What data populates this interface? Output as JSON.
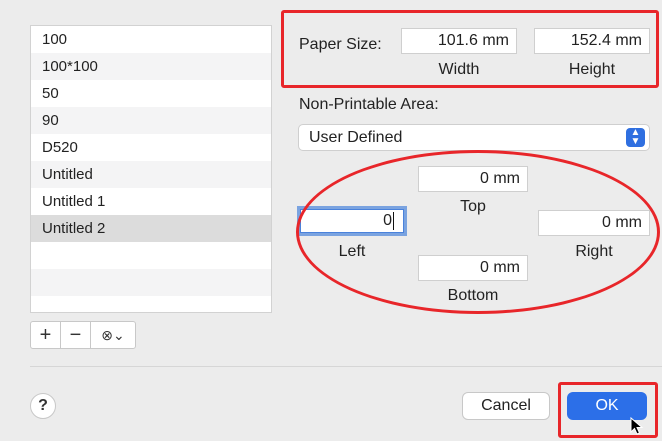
{
  "paper_list": {
    "items": [
      {
        "label": "100"
      },
      {
        "label": "100*100"
      },
      {
        "label": "50"
      },
      {
        "label": "90"
      },
      {
        "label": "D520"
      },
      {
        "label": "Untitled"
      },
      {
        "label": "Untitled 1"
      },
      {
        "label": "Untitled 2",
        "selected": true
      }
    ]
  },
  "toolbar": {
    "add_label": "+",
    "remove_label": "−",
    "options_label": "⊗⌄"
  },
  "paper_size": {
    "label": "Paper Size:",
    "width_value": "101.6 mm",
    "height_value": "152.4 mm",
    "width_caption": "Width",
    "height_caption": "Height"
  },
  "non_printable": {
    "label": "Non-Printable Area:",
    "selected_option": "User Defined",
    "top_value": "0 mm",
    "top_caption": "Top",
    "left_value": "0",
    "left_caption": "Left",
    "right_value": "0 mm",
    "right_caption": "Right",
    "bottom_value": "0 mm",
    "bottom_caption": "Bottom"
  },
  "buttons": {
    "help": "?",
    "cancel": "Cancel",
    "ok": "OK"
  },
  "colors": {
    "accent": "#2c6fe8",
    "annotation": "#e8262a"
  }
}
